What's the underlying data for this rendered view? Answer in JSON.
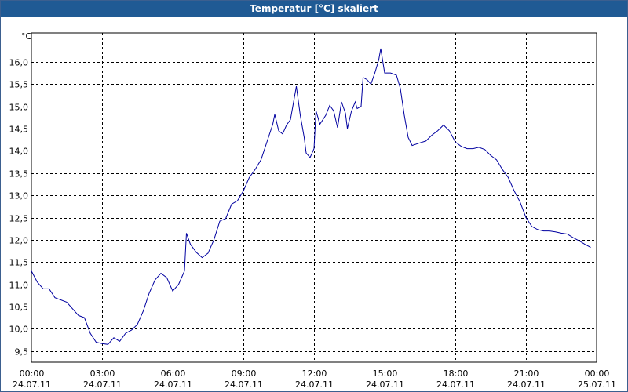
{
  "window": {
    "title": "Temperatur [°C] skaliert"
  },
  "colors": {
    "titlebar": "#1f5a94",
    "line": "#0000a0",
    "grid": "#000000"
  },
  "chart_data": {
    "type": "line",
    "title": "Temperatur [°C] skaliert",
    "unit": "°C",
    "ylim": [
      9.25,
      16.65
    ],
    "xlim": [
      "2011-07-24 00:00",
      "2011-07-25 00:00"
    ],
    "grid": true,
    "y_ticks": [
      "9,5",
      "10,0",
      "10,5",
      "11,0",
      "11,5",
      "12,0",
      "12,5",
      "13,0",
      "13,5",
      "14,0",
      "14,5",
      "15,0",
      "15,5",
      "16,0"
    ],
    "y_tick_values": [
      9.5,
      10,
      10.5,
      11,
      11.5,
      12,
      12.5,
      13,
      13.5,
      14,
      14.5,
      15,
      15.5,
      16
    ],
    "x_ticks": [
      {
        "time": "00:00",
        "date": "24.07.11"
      },
      {
        "time": "03:00",
        "date": "24.07.11"
      },
      {
        "time": "06:00",
        "date": "24.07.11"
      },
      {
        "time": "09:00",
        "date": "24.07.11"
      },
      {
        "time": "12:00",
        "date": "24.07.11"
      },
      {
        "time": "15:00",
        "date": "24.07.11"
      },
      {
        "time": "18:00",
        "date": "24.07.11"
      },
      {
        "time": "21:00",
        "date": "24.07.11"
      },
      {
        "time": "00:00",
        "date": "25.07.11"
      }
    ],
    "series": [
      {
        "values": [
          [
            "2011-07-24 00:00",
            11.3
          ],
          [
            "2011-07-24 00:15",
            11.05
          ],
          [
            "2011-07-24 00:30",
            10.9
          ],
          [
            "2011-07-24 00:45",
            10.9
          ],
          [
            "2011-07-24 01:00",
            10.7
          ],
          [
            "2011-07-24 01:30",
            10.6
          ],
          [
            "2011-07-24 02:00",
            10.3
          ],
          [
            "2011-07-24 02:15",
            10.25
          ],
          [
            "2011-07-24 02:30",
            9.9
          ],
          [
            "2011-07-24 02:45",
            9.7
          ],
          [
            "2011-07-24 03:00",
            9.67
          ],
          [
            "2011-07-24 03:15",
            9.65
          ],
          [
            "2011-07-24 03:30",
            9.8
          ],
          [
            "2011-07-24 03:45",
            9.72
          ],
          [
            "2011-07-24 04:00",
            9.9
          ],
          [
            "2011-07-24 04:15",
            9.97
          ],
          [
            "2011-07-24 04:30",
            10.1
          ],
          [
            "2011-07-24 04:45",
            10.4
          ],
          [
            "2011-07-24 05:00",
            10.8
          ],
          [
            "2011-07-24 05:15",
            11.1
          ],
          [
            "2011-07-24 05:30",
            11.25
          ],
          [
            "2011-07-24 05:45",
            11.15
          ],
          [
            "2011-07-24 06:00",
            10.85
          ],
          [
            "2011-07-24 06:15",
            11.0
          ],
          [
            "2011-07-24 06:30",
            11.3
          ],
          [
            "2011-07-24 06:35",
            12.15
          ],
          [
            "2011-07-24 06:45",
            11.9
          ],
          [
            "2011-07-24 07:00",
            11.72
          ],
          [
            "2011-07-24 07:15",
            11.6
          ],
          [
            "2011-07-24 07:30",
            11.7
          ],
          [
            "2011-07-24 07:45",
            12.0
          ],
          [
            "2011-07-24 08:00",
            12.42
          ],
          [
            "2011-07-24 08:15",
            12.48
          ],
          [
            "2011-07-24 08:30",
            12.8
          ],
          [
            "2011-07-24 08:45",
            12.88
          ],
          [
            "2011-07-24 09:00",
            13.1
          ],
          [
            "2011-07-24 09:15",
            13.4
          ],
          [
            "2011-07-24 09:30",
            13.58
          ],
          [
            "2011-07-24 09:45",
            13.8
          ],
          [
            "2011-07-24 10:00",
            14.2
          ],
          [
            "2011-07-24 10:15",
            14.6
          ],
          [
            "2011-07-24 10:20",
            14.82
          ],
          [
            "2011-07-24 10:30",
            14.45
          ],
          [
            "2011-07-24 10:40",
            14.38
          ],
          [
            "2011-07-24 10:50",
            14.58
          ],
          [
            "2011-07-24 11:00",
            14.7
          ],
          [
            "2011-07-24 11:10",
            15.2
          ],
          [
            "2011-07-24 11:15",
            15.45
          ],
          [
            "2011-07-24 11:25",
            14.8
          ],
          [
            "2011-07-24 11:35",
            14.3
          ],
          [
            "2011-07-24 11:40",
            13.95
          ],
          [
            "2011-07-24 11:50",
            13.85
          ],
          [
            "2011-07-24 12:00",
            14.05
          ],
          [
            "2011-07-24 12:05",
            14.9
          ],
          [
            "2011-07-24 12:15",
            14.6
          ],
          [
            "2011-07-24 12:30",
            14.8
          ],
          [
            "2011-07-24 12:40",
            15.02
          ],
          [
            "2011-07-24 12:50",
            14.9
          ],
          [
            "2011-07-24 13:00",
            14.52
          ],
          [
            "2011-07-24 13:10",
            15.1
          ],
          [
            "2011-07-24 13:20",
            14.85
          ],
          [
            "2011-07-24 13:25",
            14.5
          ],
          [
            "2011-07-24 13:35",
            14.88
          ],
          [
            "2011-07-24 13:45",
            15.1
          ],
          [
            "2011-07-24 13:50",
            14.95
          ],
          [
            "2011-07-24 14:00",
            15.0
          ],
          [
            "2011-07-24 14:05",
            15.65
          ],
          [
            "2011-07-24 14:15",
            15.6
          ],
          [
            "2011-07-24 14:25",
            15.5
          ],
          [
            "2011-07-24 14:35",
            15.75
          ],
          [
            "2011-07-24 14:45",
            16.05
          ],
          [
            "2011-07-24 14:50",
            16.3
          ],
          [
            "2011-07-24 15:00",
            15.75
          ],
          [
            "2011-07-24 15:15",
            15.75
          ],
          [
            "2011-07-24 15:30",
            15.7
          ],
          [
            "2011-07-24 15:40",
            15.4
          ],
          [
            "2011-07-24 15:50",
            14.8
          ],
          [
            "2011-07-24 16:00",
            14.3
          ],
          [
            "2011-07-24 16:10",
            14.12
          ],
          [
            "2011-07-24 16:30",
            14.18
          ],
          [
            "2011-07-24 16:45",
            14.22
          ],
          [
            "2011-07-24 17:00",
            14.35
          ],
          [
            "2011-07-24 17:15",
            14.45
          ],
          [
            "2011-07-24 17:30",
            14.58
          ],
          [
            "2011-07-24 17:45",
            14.45
          ],
          [
            "2011-07-24 18:00",
            14.2
          ],
          [
            "2011-07-24 18:15",
            14.1
          ],
          [
            "2011-07-24 18:30",
            14.05
          ],
          [
            "2011-07-24 18:45",
            14.05
          ],
          [
            "2011-07-24 19:00",
            14.08
          ],
          [
            "2011-07-24 19:15",
            14.03
          ],
          [
            "2011-07-24 19:30",
            13.9
          ],
          [
            "2011-07-24 19:45",
            13.8
          ],
          [
            "2011-07-24 20:00",
            13.58
          ],
          [
            "2011-07-24 20:15",
            13.4
          ],
          [
            "2011-07-24 20:30",
            13.1
          ],
          [
            "2011-07-24 20:45",
            12.85
          ],
          [
            "2011-07-24 21:00",
            12.5
          ],
          [
            "2011-07-24 21:15",
            12.3
          ],
          [
            "2011-07-24 21:30",
            12.23
          ],
          [
            "2011-07-24 21:45",
            12.2
          ],
          [
            "2011-07-24 22:00",
            12.2
          ],
          [
            "2011-07-24 22:15",
            12.18
          ],
          [
            "2011-07-24 22:30",
            12.15
          ],
          [
            "2011-07-24 22:45",
            12.13
          ],
          [
            "2011-07-24 23:00",
            12.05
          ],
          [
            "2011-07-24 23:15",
            11.98
          ],
          [
            "2011-07-24 23:30",
            11.9
          ],
          [
            "2011-07-24 23:45",
            11.83
          ]
        ]
      }
    ]
  }
}
